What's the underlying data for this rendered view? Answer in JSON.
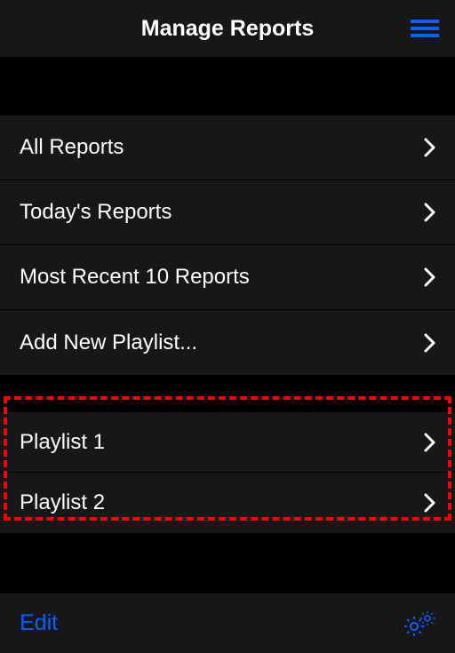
{
  "header": {
    "title": "Manage Reports"
  },
  "sections": {
    "main": [
      {
        "label": "All Reports"
      },
      {
        "label": "Today's Reports"
      },
      {
        "label": "Most Recent 10 Reports"
      },
      {
        "label": "Add New Playlist..."
      }
    ],
    "playlists": [
      {
        "label": "Playlist 1"
      },
      {
        "label": "Playlist 2"
      }
    ]
  },
  "footer": {
    "edit": "Edit"
  },
  "colors": {
    "accent": "#0b5fff",
    "highlight": "#ff0000",
    "rowBg": "#171717"
  }
}
